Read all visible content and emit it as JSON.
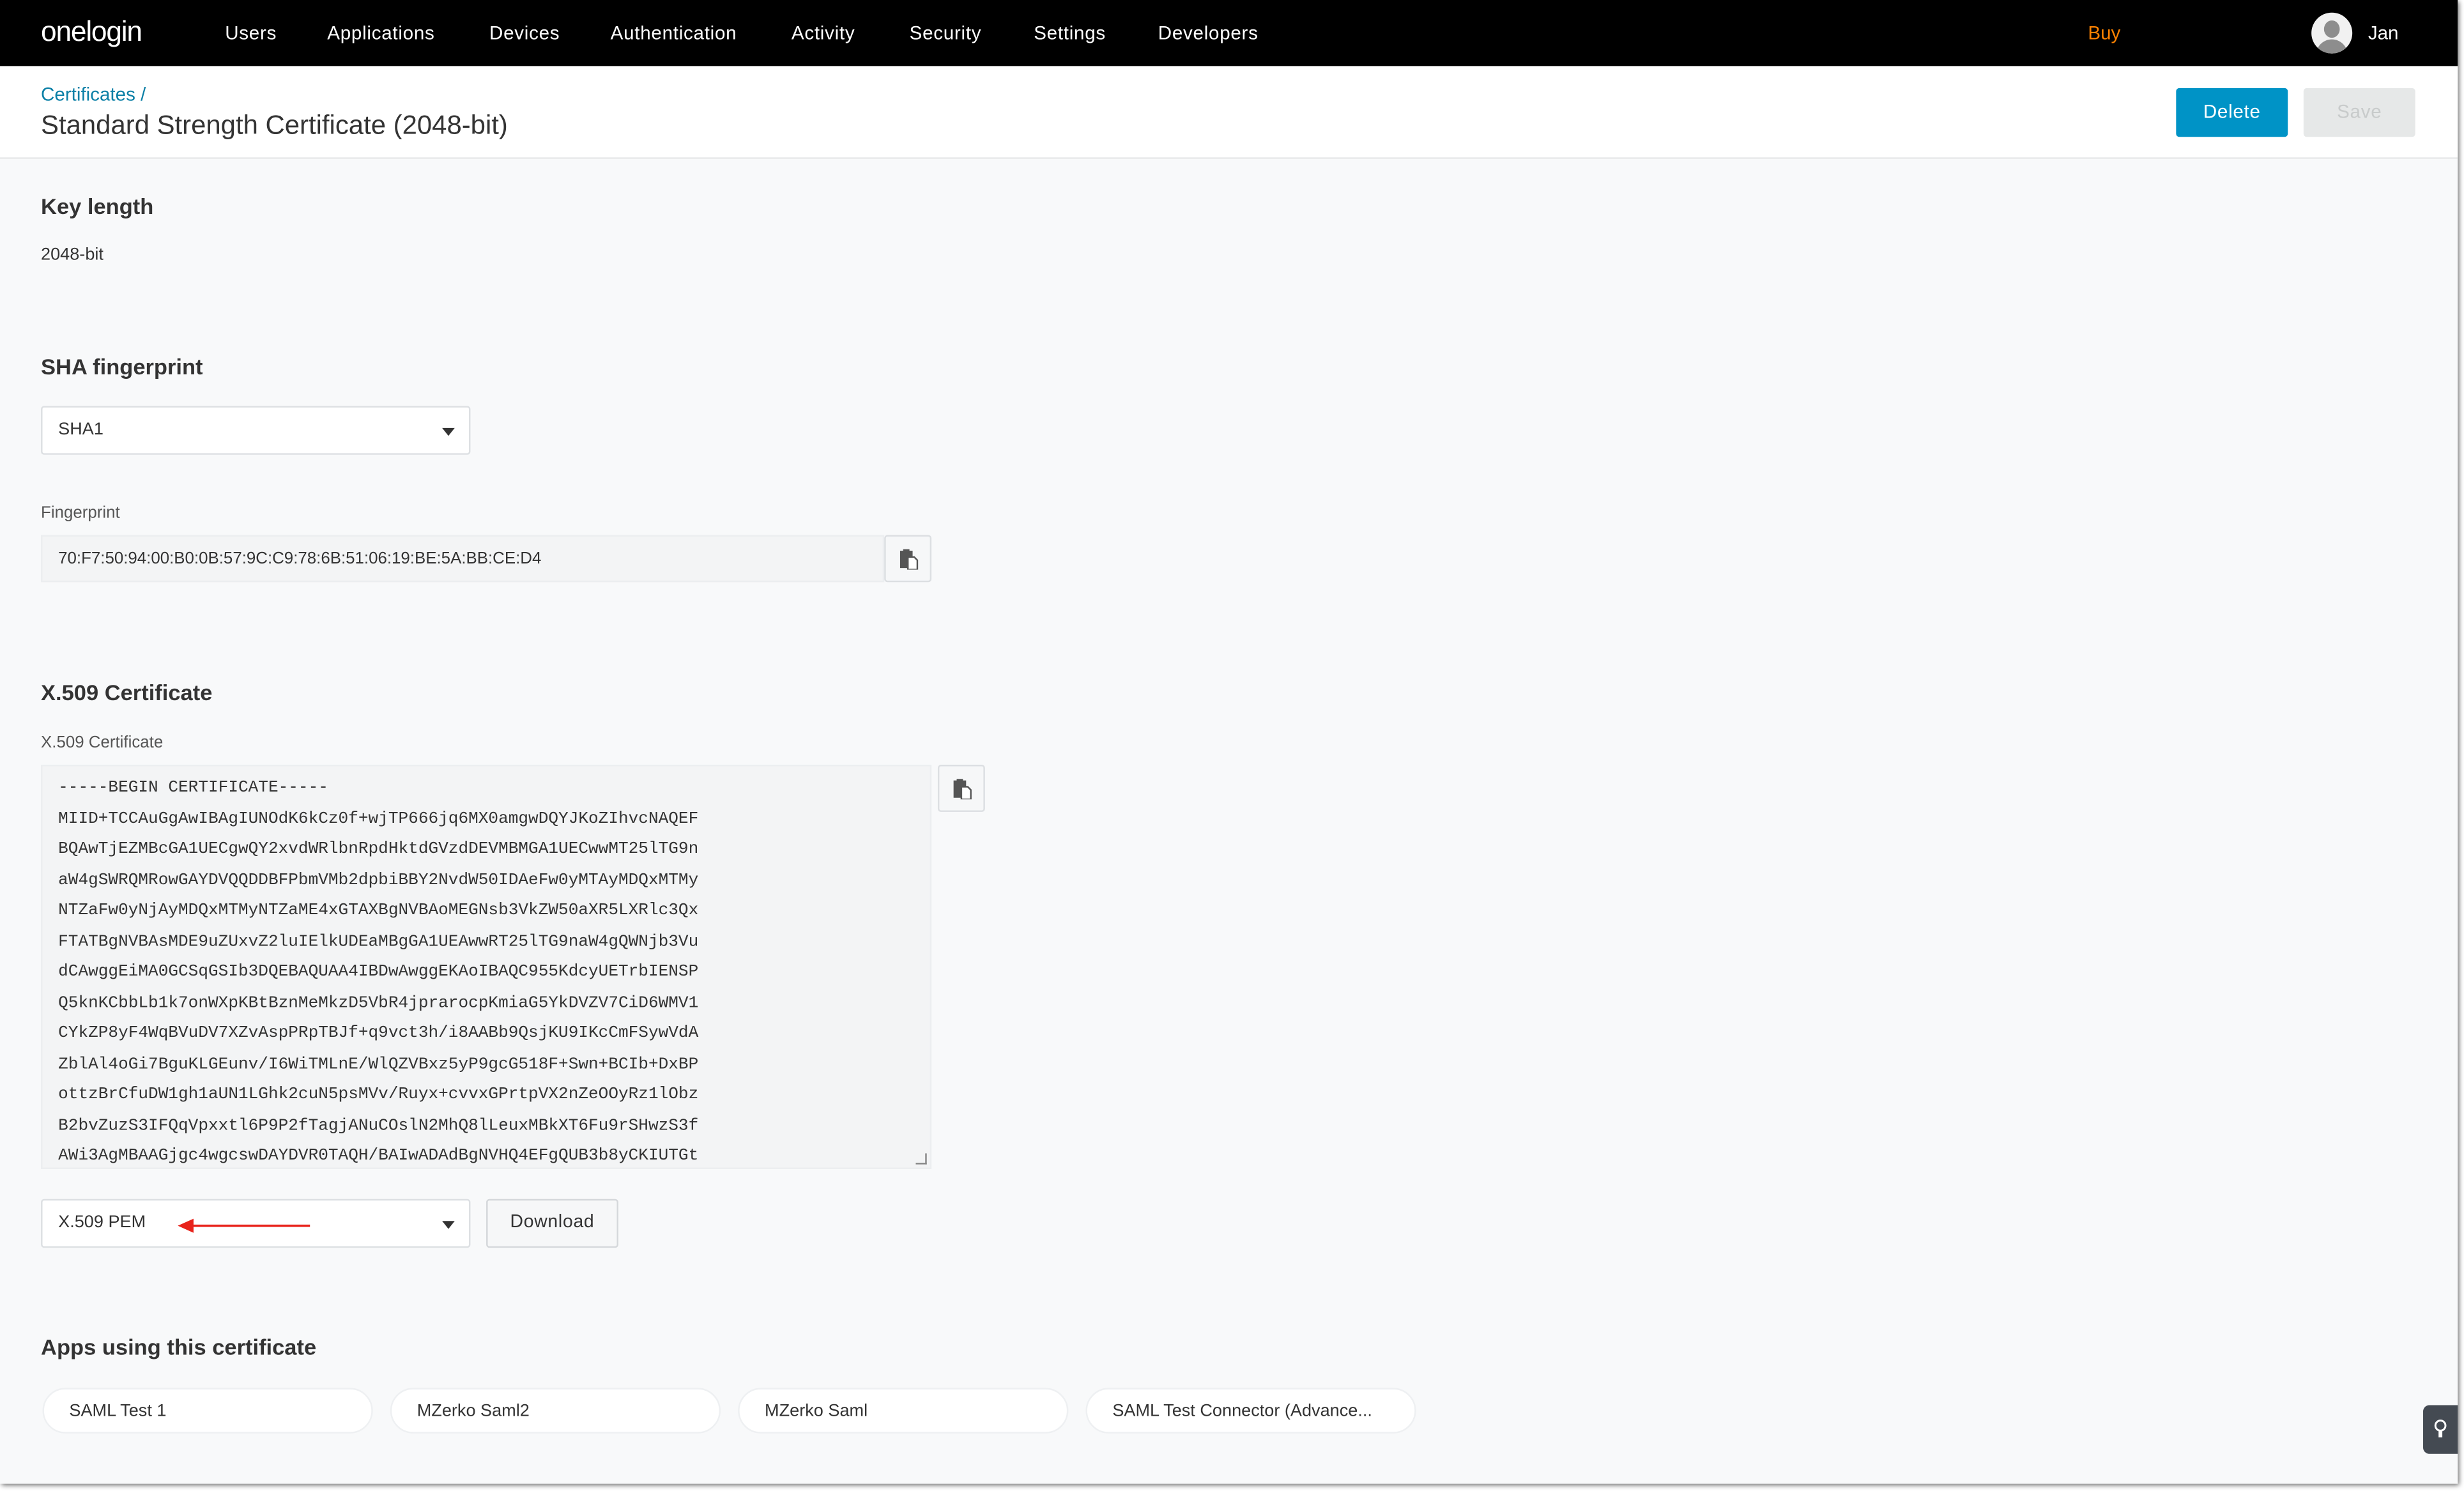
{
  "nav": {
    "logo": "onelogin",
    "items": [
      "Users",
      "Applications",
      "Devices",
      "Authentication",
      "Activity",
      "Security",
      "Settings",
      "Developers"
    ],
    "buy": "Buy",
    "user": "Jan"
  },
  "header": {
    "breadcrumb": "Certificates /",
    "title": "Standard Strength Certificate (2048-bit)",
    "delete": "Delete",
    "save": "Save"
  },
  "key_length": {
    "heading": "Key length",
    "value": "2048-bit"
  },
  "sha": {
    "heading": "SHA fingerprint",
    "algorithm": "SHA1",
    "fingerprint_label": "Fingerprint",
    "fingerprint": "70:F7:50:94:00:B0:0B:57:9C:C9:78:6B:51:06:19:BE:5A:BB:CE:D4"
  },
  "x509": {
    "heading": "X.509 Certificate",
    "label": "X.509 Certificate",
    "lines": [
      "-----BEGIN CERTIFICATE-----",
      "MIID+TCCAuGgAwIBAgIUNOdK6kCz0f+wjTP666jq6MX0amgwDQYJKoZIhvcNAQEF",
      "BQAwTjEZMBcGA1UECgwQY2xvdWRlbnRpdHktdGVzdDEVMBMGA1UECwwMT25lTG9n",
      "aW4gSWRQMRowGAYDVQQDDBFPbmVMb2dpbiBBY2NvdW50IDAeFw0yMTAyMDQxMTMy",
      "NTZaFw0yNjAyMDQxMTMyNTZaME4xGTAXBgNVBAoMEGNsb3VkZW50aXR5LXRlc3Qx",
      "FTATBgNVBAsMDE9uZUxvZ2luIElkUDEaMBgGA1UEAwwRT25lTG9naW4gQWNjb3Vu",
      "dCAwggEiMA0GCSqGSIb3DQEBAQUAA4IBDwAwggEKAoIBAQC955KdcyUETrbIENSP",
      "Q5knKCbbLb1k7onWXpKBtBznMeMkzD5VbR4jprarocpKmiaG5YkDVZV7CiD6WMV1",
      "CYkZP8yF4WqBVuDV7XZvAspPRpTBJf+q9vct3h/i8AABb9QsjKU9IKcCmFSywVdA",
      "ZblAl4oGi7BguKLGEunv/I6WiTMLnE/WlQZVBxz5yP9gcG518F+Swn+BCIb+DxBP",
      "ottzBrCfuDW1gh1aUN1LGhk2cuN5psMVv/Ruyx+cvvxGPrtpVX2nZeOOyRz1lObz",
      "B2bvZuzS3IFQqVpxxtl6P9P2fTagjANuCOslN2MhQ8lLeuxMBkXT6Fu9rSHwzS3f",
      "AWi3AgMBAAGjgc4wgcswDAYDVR0TAQH/BAIwADAdBgNVHQ4EFgQUB3b8yCKIUTGt"
    ],
    "format": "X.509 PEM",
    "download": "Download",
    "arrow_color": "#e8231b"
  },
  "apps": {
    "heading": "Apps using this certificate",
    "items": [
      "SAML Test 1",
      "MZerko Saml2",
      "MZerko Saml",
      "SAML Test Connector (Advance..."
    ]
  },
  "colors": {
    "accent": "#0093c6",
    "buy": "#ff8200",
    "link": "#0a7fa6"
  }
}
